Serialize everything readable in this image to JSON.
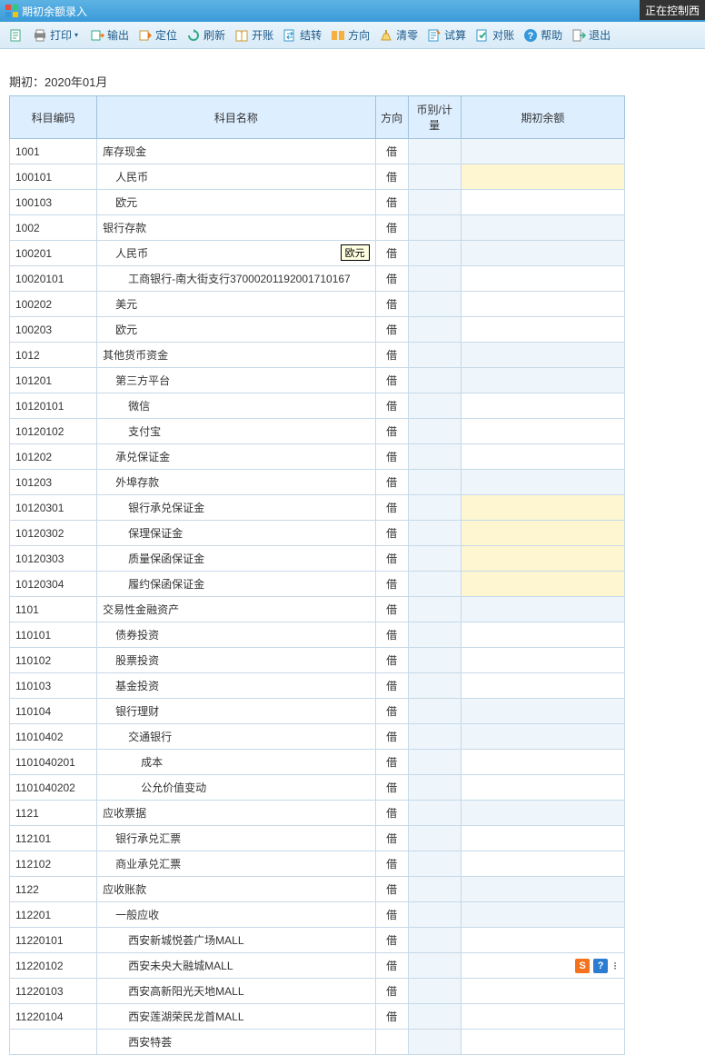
{
  "titlebar": {
    "title": "期初余额录入"
  },
  "status_banner": "正在控制西",
  "toolbar": {
    "print": "打印",
    "output": "输出",
    "locate": "定位",
    "refresh": "刷新",
    "open": "开账",
    "transfer": "结转",
    "direction": "方向",
    "clear": "清零",
    "trial": "试算",
    "recon": "对账",
    "help": "帮助",
    "exit": "退出"
  },
  "period": {
    "label": "期初：",
    "value": "2020年01月"
  },
  "headers": {
    "code": "科目编码",
    "name": "科目名称",
    "dir": "方向",
    "cur": "币别/计量",
    "bal": "期初余额"
  },
  "tooltip_text": "欧元",
  "rows": [
    {
      "code": "1001",
      "name": "库存现金",
      "indent": 0,
      "dir": "借",
      "bal_shade": true
    },
    {
      "code": "100101",
      "name": "人民币",
      "indent": 1,
      "dir": "借",
      "bal_yellow": true
    },
    {
      "code": "100103",
      "name": "欧元",
      "indent": 1,
      "dir": "借"
    },
    {
      "code": "1002",
      "name": "银行存款",
      "indent": 0,
      "dir": "借",
      "bal_shade": true
    },
    {
      "code": "100201",
      "name": "人民币",
      "indent": 1,
      "dir": "借",
      "bal_shade": true,
      "tooltip": true
    },
    {
      "code": "10020101",
      "name": "工商银行-南大街支行37000201192001710167",
      "indent": 2,
      "dir": "借"
    },
    {
      "code": "100202",
      "name": "美元",
      "indent": 1,
      "dir": "借"
    },
    {
      "code": "100203",
      "name": "欧元",
      "indent": 1,
      "dir": "借"
    },
    {
      "code": "1012",
      "name": "其他货币资金",
      "indent": 0,
      "dir": "借",
      "bal_shade": true
    },
    {
      "code": "101201",
      "name": "第三方平台",
      "indent": 1,
      "dir": "借",
      "bal_shade": true
    },
    {
      "code": "10120101",
      "name": "微信",
      "indent": 2,
      "dir": "借"
    },
    {
      "code": "10120102",
      "name": "支付宝",
      "indent": 2,
      "dir": "借"
    },
    {
      "code": "101202",
      "name": "承兑保证金",
      "indent": 1,
      "dir": "借"
    },
    {
      "code": "101203",
      "name": "外埠存款",
      "indent": 1,
      "dir": "借",
      "bal_shade": true
    },
    {
      "code": "10120301",
      "name": "银行承兑保证金",
      "indent": 2,
      "dir": "借",
      "bal_yellow": true
    },
    {
      "code": "10120302",
      "name": "保理保证金",
      "indent": 2,
      "dir": "借",
      "bal_yellow": true
    },
    {
      "code": "10120303",
      "name": "质量保函保证金",
      "indent": 2,
      "dir": "借",
      "bal_yellow": true
    },
    {
      "code": "10120304",
      "name": "履约保函保证金",
      "indent": 2,
      "dir": "借",
      "bal_yellow": true
    },
    {
      "code": "1101",
      "name": "交易性金融资产",
      "indent": 0,
      "dir": "借",
      "bal_shade": true
    },
    {
      "code": "110101",
      "name": "债券投资",
      "indent": 1,
      "dir": "借"
    },
    {
      "code": "110102",
      "name": "股票投资",
      "indent": 1,
      "dir": "借"
    },
    {
      "code": "110103",
      "name": "基金投资",
      "indent": 1,
      "dir": "借"
    },
    {
      "code": "110104",
      "name": "银行理财",
      "indent": 1,
      "dir": "借",
      "bal_shade": true
    },
    {
      "code": "11010402",
      "name": "交通银行",
      "indent": 2,
      "dir": "借",
      "bal_shade": true
    },
    {
      "code": "1101040201",
      "name": "成本",
      "indent": 3,
      "dir": "借"
    },
    {
      "code": "1101040202",
      "name": "公允价值变动",
      "indent": 3,
      "dir": "借"
    },
    {
      "code": "1121",
      "name": "应收票据",
      "indent": 0,
      "dir": "借",
      "bal_shade": true
    },
    {
      "code": "112101",
      "name": "银行承兑汇票",
      "indent": 1,
      "dir": "借"
    },
    {
      "code": "112102",
      "name": "商业承兑汇票",
      "indent": 1,
      "dir": "借"
    },
    {
      "code": "1122",
      "name": "应收账款",
      "indent": 0,
      "dir": "借",
      "bal_shade": true
    },
    {
      "code": "112201",
      "name": "一般应收",
      "indent": 1,
      "dir": "借",
      "bal_shade": true
    },
    {
      "code": "11220101",
      "name": "西安新城悦荟广场MALL",
      "indent": 2,
      "dir": "借"
    },
    {
      "code": "11220102",
      "name": "西安未央大融城MALL",
      "indent": 2,
      "dir": "借",
      "bal_icons": true
    },
    {
      "code": "11220103",
      "name": "西安高新阳光天地MALL",
      "indent": 2,
      "dir": "借"
    },
    {
      "code": "11220104",
      "name": "西安莲湖荣民龙首MALL",
      "indent": 2,
      "dir": "借"
    },
    {
      "code": "",
      "name": "西安特荟",
      "indent": 2,
      "dir": "",
      "partial": true
    }
  ],
  "bal_icon_labels": {
    "s": "S",
    "q": "?"
  }
}
